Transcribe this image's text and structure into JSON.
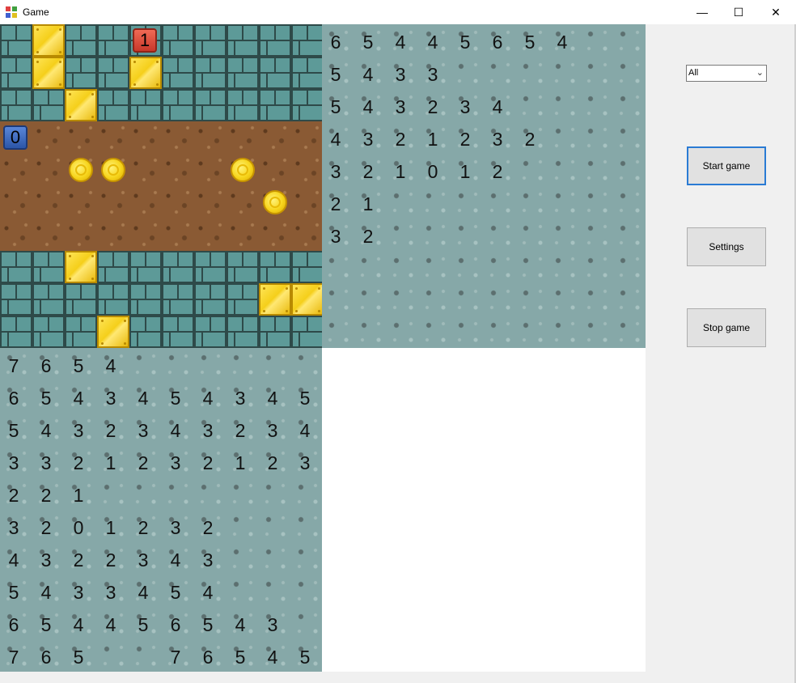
{
  "window": {
    "title": "Game",
    "controls": {
      "minimize": "—",
      "maximize": "☐",
      "close": "✕"
    }
  },
  "sidebar": {
    "filter_value": "All",
    "start_label": "Start game",
    "settings_label": "Settings",
    "stop_label": "Stop game"
  },
  "game_board": {
    "rows": [
      "BGBBRBBBBB",
      "BGBBGBBBBB",
      "BBGBBBBBBB",
      "DDDDDDDDDD",
      "DDDDDDDDDD",
      "DDDDDDDDDD",
      "DDDDDDDDDD",
      "BBGBBBBBBB",
      "BBBBBBBBGG",
      "BBBGBBBBBB"
    ],
    "coins": [
      [
        4,
        2
      ],
      [
        4,
        3
      ],
      [
        4,
        7
      ],
      [
        5,
        8
      ]
    ],
    "players": [
      {
        "label": "1",
        "row": 0,
        "col": 4,
        "color": "red"
      },
      {
        "label": "0",
        "row": 3,
        "col": 0,
        "color": "blue"
      }
    ]
  },
  "distance_map_1": [
    [
      "6",
      "5",
      "4",
      "4",
      "5",
      "6",
      "5",
      "4",
      "",
      ""
    ],
    [
      "5",
      "4",
      "3",
      "3",
      "",
      "",
      "",
      "",
      "",
      ""
    ],
    [
      "5",
      "4",
      "3",
      "2",
      "3",
      "4",
      "",
      "",
      "",
      ""
    ],
    [
      "4",
      "3",
      "2",
      "1",
      "2",
      "3",
      "2",
      "",
      "",
      ""
    ],
    [
      "3",
      "2",
      "1",
      "0",
      "1",
      "2",
      "",
      "",
      "",
      ""
    ],
    [
      "2",
      "1",
      "",
      "",
      "",
      "",
      "",
      "",
      "",
      ""
    ],
    [
      "3",
      "2",
      "",
      "",
      "",
      "",
      "",
      "",
      "",
      ""
    ],
    [
      "",
      "",
      "",
      "",
      "",
      "",
      "",
      "",
      "",
      ""
    ],
    [
      "",
      "",
      "",
      "",
      "",
      "",
      "",
      "",
      "",
      ""
    ],
    [
      "",
      "",
      "",
      "",
      "",
      "",
      "",
      "",
      "",
      ""
    ]
  ],
  "distance_map_0": [
    [
      "7",
      "6",
      "5",
      "4",
      "",
      "",
      "",
      "",
      "",
      ""
    ],
    [
      "6",
      "5",
      "4",
      "3",
      "4",
      "5",
      "4",
      "3",
      "4",
      "5"
    ],
    [
      "5",
      "4",
      "3",
      "2",
      "3",
      "4",
      "3",
      "2",
      "3",
      "4"
    ],
    [
      "3",
      "3",
      "2",
      "1",
      "2",
      "3",
      "2",
      "1",
      "2",
      "3"
    ],
    [
      "2",
      "2",
      "1",
      "",
      "",
      "",
      "",
      "",
      "",
      ""
    ],
    [
      "3",
      "2",
      "0",
      "1",
      "2",
      "3",
      "2",
      "",
      "",
      ""
    ],
    [
      "4",
      "3",
      "2",
      "2",
      "3",
      "4",
      "3",
      "",
      "",
      ""
    ],
    [
      "5",
      "4",
      "3",
      "3",
      "4",
      "5",
      "4",
      "",
      "",
      ""
    ],
    [
      "6",
      "5",
      "4",
      "4",
      "5",
      "6",
      "5",
      "4",
      "3",
      ""
    ],
    [
      "7",
      "6",
      "5",
      "",
      "",
      "7",
      "6",
      "5",
      "4",
      "5"
    ]
  ]
}
